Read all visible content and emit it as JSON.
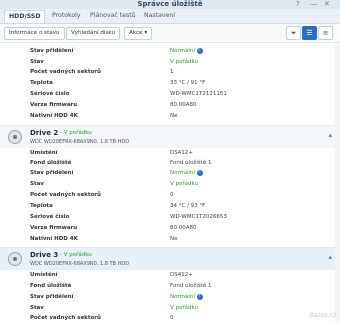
{
  "window": {
    "title": "Správce úložiště",
    "help": "?",
    "minimize": "—",
    "close": "✕"
  },
  "tabs": [
    {
      "label": "HDD/SSD"
    },
    {
      "label": "Protokoly"
    },
    {
      "label": "Plánovač testů"
    },
    {
      "label": "Nastavení"
    }
  ],
  "toolbar": {
    "info_button": "Informace o stavu",
    "locate_button": "Vyhledání disku",
    "actions_button": "Akce ▾"
  },
  "top_block": {
    "rows": [
      {
        "label": "Stav přidělení",
        "value": "Normální",
        "ok": true,
        "info": true
      },
      {
        "label": "Stav",
        "value": "V pořádku",
        "ok": true
      },
      {
        "label": "Počet vadných sektorů",
        "value": "1"
      },
      {
        "label": "Teplota",
        "value": "33 °C / 91 °F"
      },
      {
        "label": "Sériové číslo",
        "value": "WD-WMC1T2121151"
      },
      {
        "label": "Verze firmwaru",
        "value": "80.00A80"
      },
      {
        "label": "Nativní HDD 4K",
        "value": "Ne"
      }
    ]
  },
  "drive2": {
    "name": "Drive 2",
    "status": "- V pořádku",
    "model": "WDC WD20EFRX-68AX9N0, 1.8 TB HDD",
    "rows": [
      {
        "label": "Umístění",
        "value": "DS412+"
      },
      {
        "label": "Fond úložiště",
        "value": "Fond úložiště 1"
      },
      {
        "label": "Stav přidělení",
        "value": "Normální",
        "ok": true,
        "info": true
      },
      {
        "label": "Stav",
        "value": "V pořádku",
        "ok": true
      },
      {
        "label": "Počet vadných sektorů",
        "value": "0"
      },
      {
        "label": "Teplota",
        "value": "34 °C / 93 °F"
      },
      {
        "label": "Sériové číslo",
        "value": "WD-WMC1T2026653"
      },
      {
        "label": "Verze firmwaru",
        "value": "80.00A80"
      },
      {
        "label": "Nativní HDD 4K",
        "value": "Ne"
      }
    ]
  },
  "drive3": {
    "name": "Drive 3",
    "status": "- V pořádku",
    "model": "WDC WD20EFRX-68AX9N0, 1.8 TB HDD",
    "rows": [
      {
        "label": "Umístění",
        "value": "DS412+"
      },
      {
        "label": "Fond úložiště",
        "value": "Fond úložiště 1"
      },
      {
        "label": "Stav přidělení",
        "value": "Normální",
        "ok": true,
        "info": true
      },
      {
        "label": "Stav",
        "value": "V pořádku",
        "ok": true
      },
      {
        "label": "Počet vadných sektorů",
        "value": "0"
      }
    ]
  },
  "watermark": "Bazos.cz"
}
